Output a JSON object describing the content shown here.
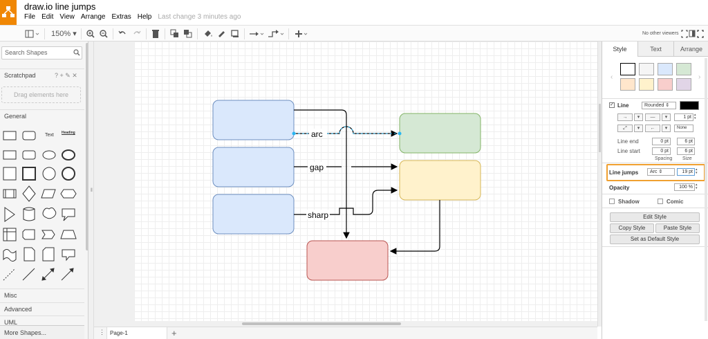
{
  "app": {
    "title": "draw.io line jumps",
    "menu": [
      "File",
      "Edit",
      "View",
      "Arrange",
      "Extras",
      "Help"
    ],
    "last_change": "Last change 3 minutes ago"
  },
  "toolbar": {
    "zoom": "150%",
    "viewers": "No other viewers"
  },
  "sidebar": {
    "search_placeholder": "Search Shapes",
    "scratchpad": "Scratchpad",
    "scratchpad_icons": "? + ✎ ✕",
    "dropzone": "Drag elements here",
    "general": "General",
    "text_shape": "Text",
    "heading_shape": "Heading",
    "misc": "Misc",
    "advanced": "Advanced",
    "uml": "UML",
    "more_shapes": "More Shapes..."
  },
  "diagram": {
    "edge_labels": [
      "arc",
      "gap",
      "sharp"
    ],
    "colors": {
      "blue_fill": "#dae8fc",
      "blue_stroke": "#6c8ebf",
      "green_fill": "#d5e8d4",
      "green_stroke": "#82b366",
      "yellow_fill": "#fff2cc",
      "yellow_stroke": "#d6b656",
      "red_fill": "#f8cecc",
      "red_stroke": "#b85450"
    }
  },
  "bottom": {
    "page_tab": "Page-1",
    "add_page": "+"
  },
  "panel": {
    "tabs": [
      "Style",
      "Text",
      "Arrange"
    ],
    "swatch_colors": [
      "#ffffff",
      "#f5f5f5",
      "#dae8fc",
      "#d5e8d4",
      "#ffe6cc",
      "#fff2cc",
      "#f8cecc",
      "#e1d5e7"
    ],
    "line_label": "Line",
    "line_style": "Rounded",
    "line_color": "#000000",
    "line_width": "1 pt",
    "waypoint_style": "None",
    "line_end_label": "Line end",
    "line_start_label": "Line start",
    "line_end_spacing": "0 pt",
    "line_end_size": "6 pt",
    "line_start_spacing": "0 pt",
    "line_start_size": "6 pt",
    "spacing_label": "Spacing",
    "size_label": "Size",
    "line_jumps_label": "Line jumps",
    "line_jumps_style": "Arc",
    "line_jumps_size": "19 pt",
    "opacity_label": "Opacity",
    "opacity_value": "100 %",
    "shadow_label": "Shadow",
    "comic_label": "Comic",
    "edit_style": "Edit Style",
    "copy_style": "Copy Style",
    "paste_style": "Paste Style",
    "set_default": "Set as Default Style",
    "highlight_color": "#f0a030"
  }
}
